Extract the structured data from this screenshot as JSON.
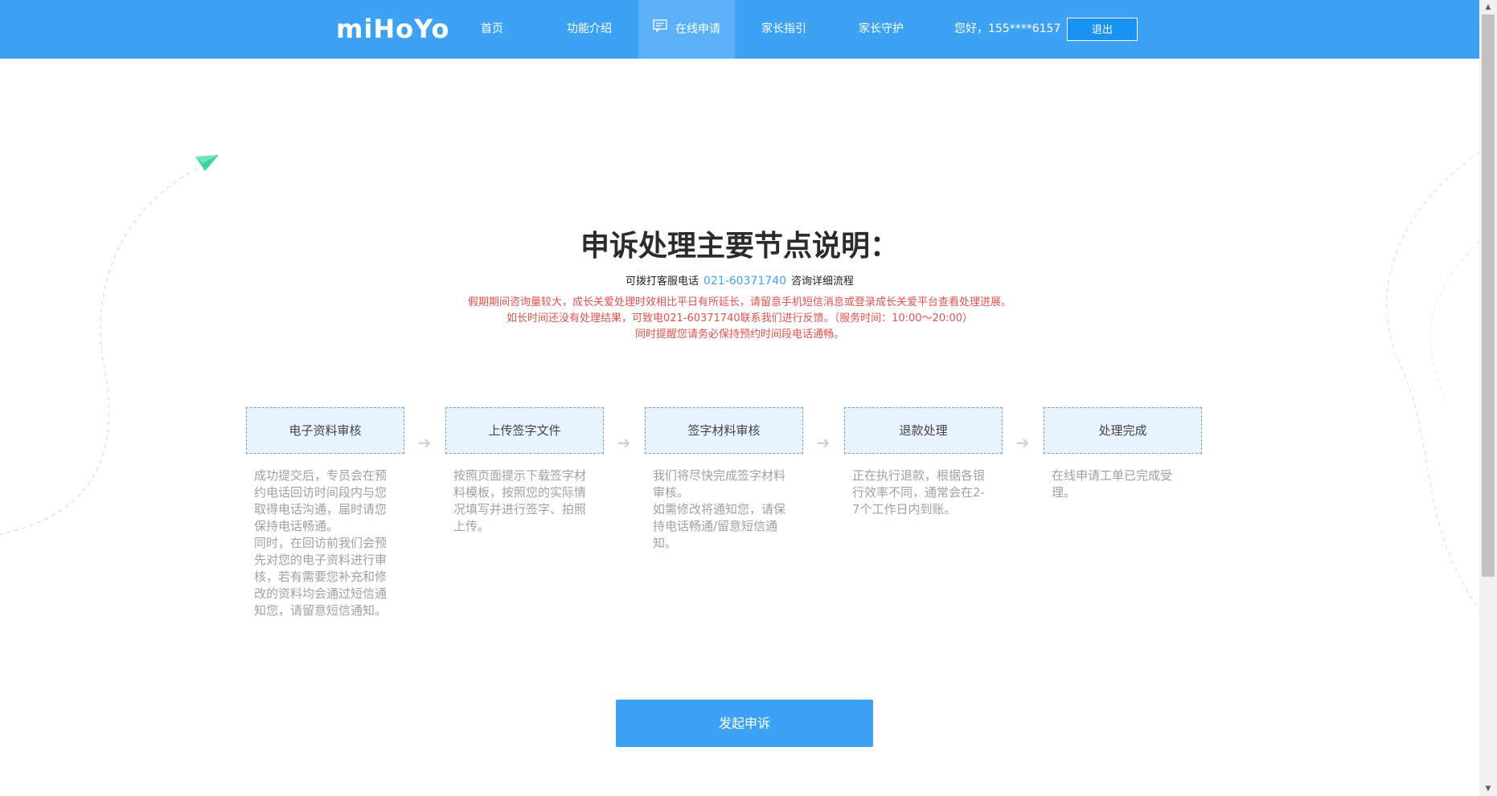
{
  "header": {
    "logo": "miHoYo",
    "nav": [
      {
        "label": "首页"
      },
      {
        "label": "功能介绍"
      },
      {
        "label": "在线申请"
      },
      {
        "label": "家长指引"
      },
      {
        "label": "家长守护"
      }
    ],
    "greeting": "您好，155****6157",
    "logout_label": "退出"
  },
  "main": {
    "title": "申诉处理主要节点说明：",
    "hotline_prefix": "可拨打客服电话",
    "hotline_phone": "021-60371740",
    "hotline_suffix": "咨询详细流程",
    "notice_lines": [
      "假期期间咨询量较大，成长关爱处理时效相比平日有所延长，请留意手机短信消息或登录成长关爱平台查看处理进展。",
      "如长时间还没有处理结果，可致电021-60371740联系我们进行反馈。（服务时间：10:00～20:00）",
      "同时提醒您请务必保持预约时间段电话通畅。"
    ],
    "steps": [
      {
        "label": "电子资料审核",
        "desc": [
          "成功提交后，专员会在预",
          "约电话回访时间段内与您",
          "取得电话沟通，届时请您",
          "保持电话畅通。",
          "同时，在回访前我们会预",
          "先对您的电子资料进行审",
          "核，若有需要您补充和修",
          "改的资料均会通过短信通",
          "知您，请留意短信通知。"
        ]
      },
      {
        "label": "上传签字文件",
        "desc": [
          "按照页面提示下载签字材",
          "料模板，按照您的实际情",
          "况填写并进行签字、拍照",
          "上传。"
        ]
      },
      {
        "label": "签字材料审核",
        "desc": [
          "我们将尽快完成签字材料",
          "审核。",
          "如需修改将通知您，请保",
          "持电话畅通/留意短信通",
          "知。"
        ]
      },
      {
        "label": "退款处理",
        "desc": [
          "正在执行退款，根据各银",
          "行效率不同，通常会在2-",
          "7个工作日内到账。"
        ]
      },
      {
        "label": "处理完成",
        "desc": [
          "在线申请工单已完成受",
          "理。"
        ]
      }
    ],
    "submit_label": "发起申诉"
  },
  "colors": {
    "header_bg": "#3ea2f4",
    "accent": "#3ea2f4",
    "notice": "#e4524c",
    "step_bg": "#e7f3fd"
  }
}
